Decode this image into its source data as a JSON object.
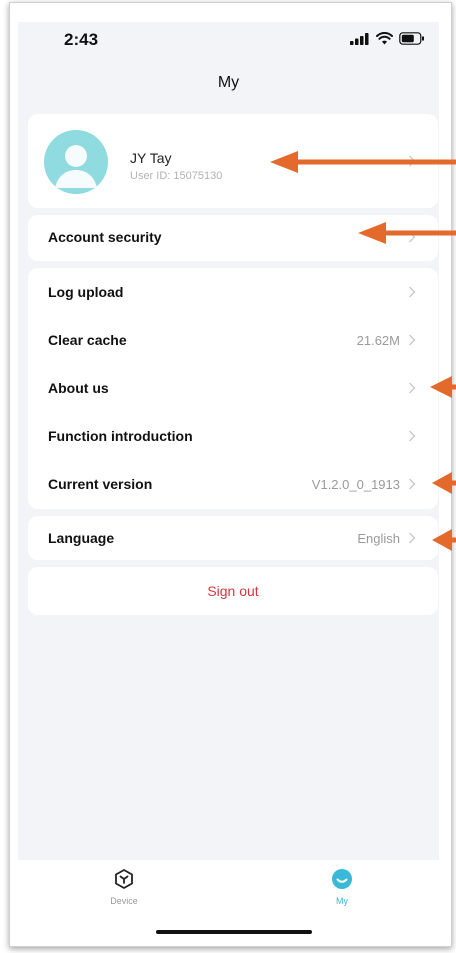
{
  "status_bar": {
    "time": "2:43"
  },
  "page": {
    "title": "My"
  },
  "profile": {
    "name": "JY Tay",
    "user_id": "User ID: 15075130"
  },
  "menu": {
    "account_security": "Account security",
    "log_upload": "Log upload",
    "clear_cache": {
      "label": "Clear cache",
      "value": "21.62M"
    },
    "about_us": "About us",
    "function_introduction": "Function introduction",
    "current_version": {
      "label": "Current version",
      "value": "V1.2.0_0_1913"
    },
    "language": {
      "label": "Language",
      "value": "English"
    },
    "sign_out": "Sign out"
  },
  "tabbar": {
    "device": "Device",
    "my": "My"
  },
  "colors": {
    "accent": "#39b9d8",
    "sign_out": "#d9333f",
    "annotation_arrow": "#e46a2c"
  }
}
